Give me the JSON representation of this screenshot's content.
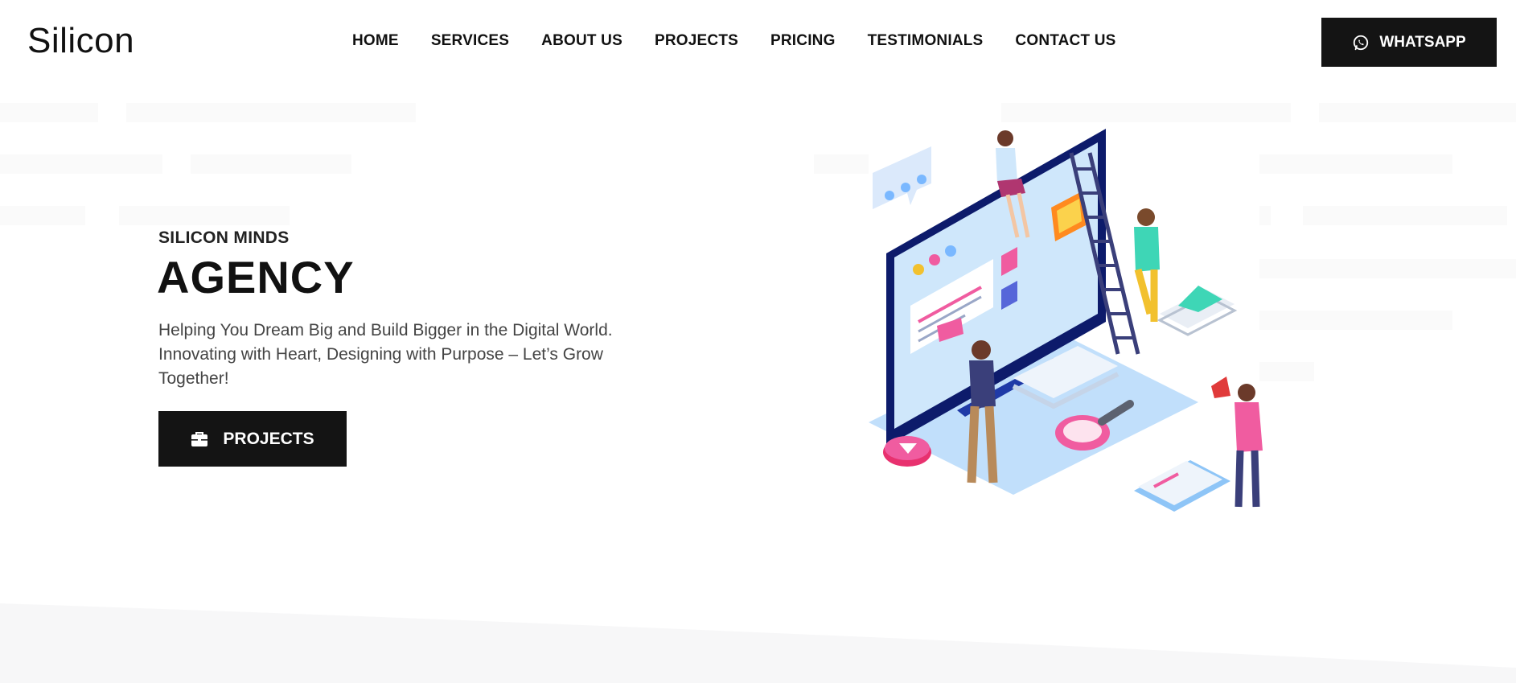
{
  "brand": {
    "name": "Silicon"
  },
  "nav": {
    "items": [
      {
        "label": "HOME"
      },
      {
        "label": "SERVICES"
      },
      {
        "label": "ABOUT US"
      },
      {
        "label": "PROJECTS"
      },
      {
        "label": "PRICING"
      },
      {
        "label": "TESTIMONIALS"
      },
      {
        "label": "CONTACT US"
      }
    ]
  },
  "header": {
    "whatsapp_label": "WHATSAPP"
  },
  "hero": {
    "kicker": "SILICON MINDS",
    "title": "AGENCY",
    "description": "Helping You Dream Big and Build Bigger in the Digital World. Innovating with Heart, Designing with Purpose – Let’s Grow Together!",
    "cta_label": "PROJECTS"
  },
  "icons": {
    "whatsapp": "whatsapp-icon",
    "cta": "briefcase-icon",
    "illustration": "isometric-web-design-team-illustration"
  },
  "colors": {
    "button_bg": "#141414",
    "button_text": "#ffffff",
    "text": "#111111",
    "muted_text": "#444444",
    "placeholder_bar": "#fafafa"
  }
}
